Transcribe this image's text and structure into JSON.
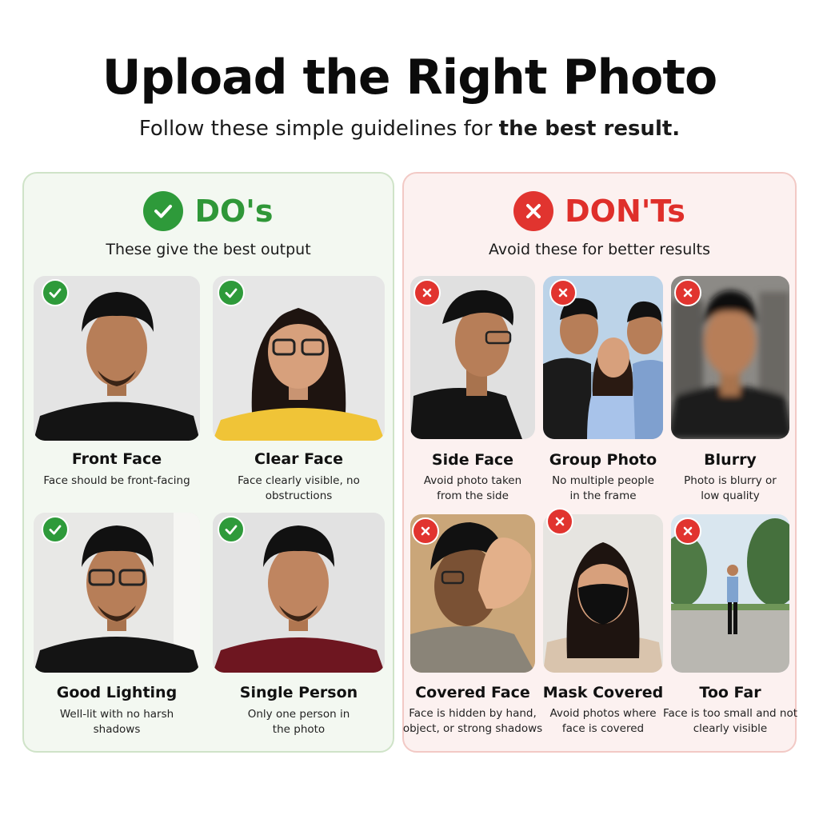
{
  "header": {
    "title": "Upload the Right Photo",
    "subtitle_prefix": "Follow these simple guidelines for ",
    "subtitle_bold": "the best result."
  },
  "dos": {
    "title": "DO's",
    "subtitle": "These give the best output",
    "accent": "#2e9a3a",
    "items": [
      {
        "title": "Front Face",
        "desc": "Face should be front-facing"
      },
      {
        "title": "Clear Face",
        "desc": "Face clearly visible, no\nobstructions"
      },
      {
        "title": "Good Lighting",
        "desc": "Well-lit with no harsh\nshadows"
      },
      {
        "title": "Single Person",
        "desc": "Only one person in\nthe photo"
      }
    ]
  },
  "donts": {
    "title": "DON'Ts",
    "subtitle": "Avoid these for better results",
    "accent": "#e1342f",
    "items": [
      {
        "title": "Side Face",
        "desc": "Avoid photo taken\nfrom the side"
      },
      {
        "title": "Group Photo",
        "desc": "No multiple people\nin the frame"
      },
      {
        "title": "Blurry",
        "desc": "Photo is blurry or\nlow quality"
      },
      {
        "title": "Covered Face",
        "desc": "Face is hidden by hand,\nobject, or strong shadows"
      },
      {
        "title": "Mask Covered",
        "desc": "Avoid photos where\nface is covered"
      },
      {
        "title": "Too Far",
        "desc": "Face is too small and not\nclearly visible"
      }
    ]
  }
}
